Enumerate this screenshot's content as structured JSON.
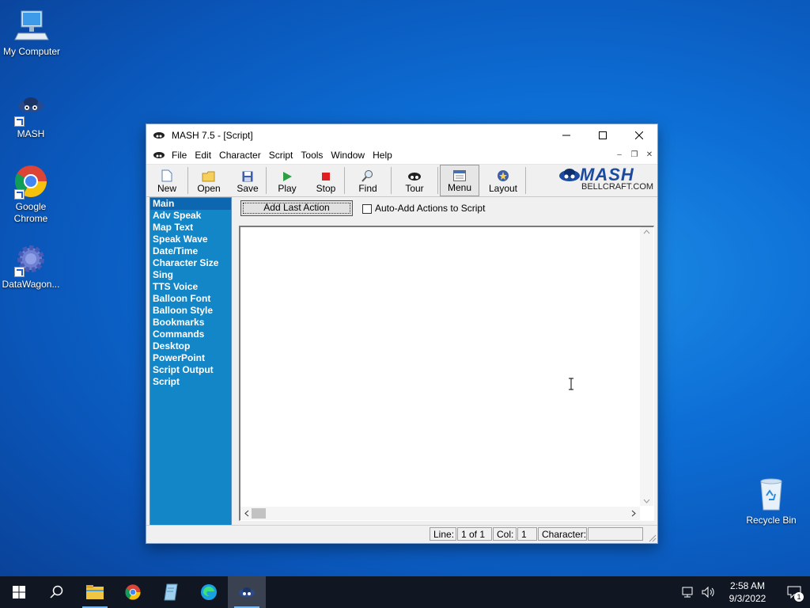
{
  "desktop": {
    "icons": [
      {
        "label": "My Computer"
      },
      {
        "label": "MASH"
      },
      {
        "label": "Google Chrome"
      },
      {
        "label": "DataWagon..."
      },
      {
        "label": "Recycle Bin"
      }
    ]
  },
  "window": {
    "title": "MASH 7.5 - [Script]",
    "menu": [
      "File",
      "Edit",
      "Character",
      "Script",
      "Tools",
      "Window",
      "Help"
    ],
    "toolbar": {
      "new": "New",
      "open": "Open",
      "save": "Save",
      "play": "Play",
      "stop": "Stop",
      "find": "Find",
      "tour": "Tour",
      "menu": "Menu",
      "layout": "Layout"
    },
    "logo": {
      "text": "MASH",
      "sub": "BELLCRAFT.COM"
    },
    "sidebar": [
      "Main",
      "Adv Speak",
      "Map Text",
      "Speak Wave",
      "Date/Time",
      "Character Size",
      "Sing",
      "TTS Voice",
      "Balloon Font",
      "Balloon Style",
      "Bookmarks",
      "Commands",
      "Desktop",
      "PowerPoint",
      "Script Output",
      "Script"
    ],
    "content": {
      "add_button": "Add Last Action",
      "auto_add_label": "Auto-Add Actions to Script",
      "auto_add_checked": false
    },
    "status": {
      "line_label": "Line:",
      "line_value": "1 of 1",
      "col_label": "Col:",
      "col_value": "1",
      "char_label": "Character:",
      "char_value": ""
    }
  },
  "taskbar": {
    "time": "2:58 AM",
    "date": "9/3/2022",
    "notification_count": "1"
  },
  "colors": {
    "sidebar_bg": "#1386c8",
    "taskbar_bg": "#101722",
    "accent": "#0078d7"
  }
}
